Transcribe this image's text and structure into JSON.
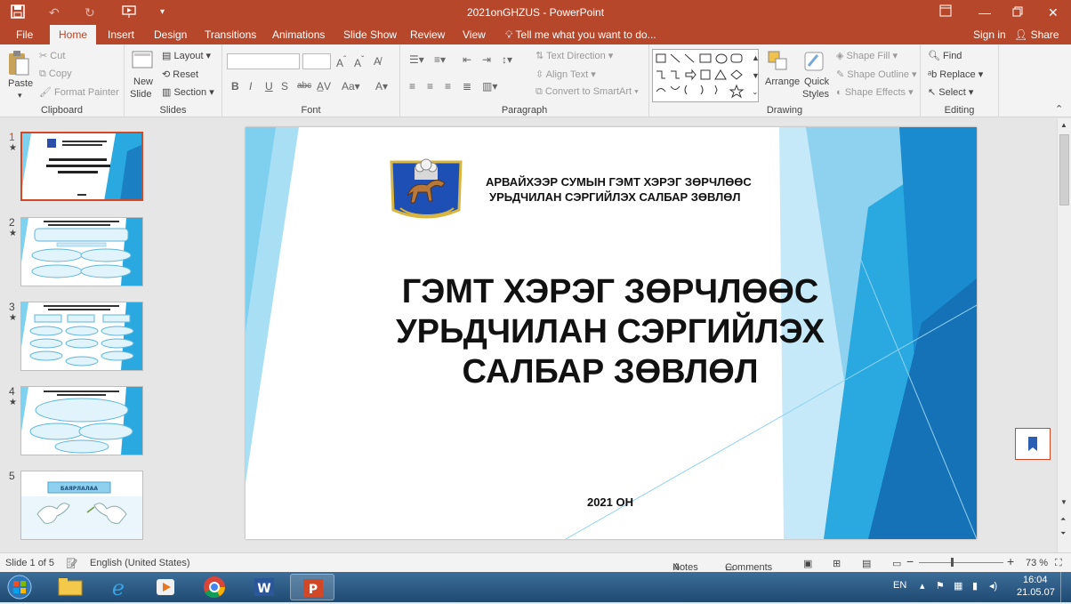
{
  "window": {
    "title": "2021onGHZUS - PowerPoint"
  },
  "tabs": [
    "File",
    "Home",
    "Insert",
    "Design",
    "Transitions",
    "Animations",
    "Slide Show",
    "Review",
    "View"
  ],
  "tellme": "Tell me what you want to do...",
  "account": {
    "signin": "Sign in",
    "share": "Share"
  },
  "clipboard": {
    "paste": "Paste",
    "cut": "Cut",
    "copy": "Copy",
    "format_painter": "Format Painter",
    "label": "Clipboard"
  },
  "slides_group": {
    "new_slide_1": "New",
    "new_slide_2": "Slide",
    "layout": "Layout",
    "reset": "Reset",
    "section": "Section",
    "label": "Slides"
  },
  "font_group": {
    "label": "Font"
  },
  "paragraph_group": {
    "text_direction": "Text Direction",
    "align_text": "Align Text",
    "convert_smartart": "Convert to SmartArt",
    "label": "Paragraph"
  },
  "drawing_group": {
    "arrange": "Arrange",
    "quick_styles_1": "Quick",
    "quick_styles_2": "Styles",
    "shape_fill": "Shape Fill",
    "shape_outline": "Shape Outline",
    "shape_effects": "Shape Effects",
    "label": "Drawing"
  },
  "editing_group": {
    "find": "Find",
    "replace": "Replace",
    "select": "Select",
    "label": "Editing"
  },
  "thumbnails": [
    {
      "num": "1",
      "star": "★"
    },
    {
      "num": "2",
      "star": "★"
    },
    {
      "num": "3",
      "star": "★"
    },
    {
      "num": "4",
      "star": "★"
    },
    {
      "num": "5",
      "star": ""
    }
  ],
  "thumb5_banner": "БАЯРЛАЛАА",
  "slide": {
    "header_line1": "АРВАЙХЭЭР СУМЫН ГЭМТ ХЭРЭГ ЗӨРЧЛӨӨС",
    "header_line2": "УРЬДЧИЛАН СЭРГИЙЛЭХ САЛБАР ЗӨВЛӨЛ",
    "title_line1": "ГЭМТ ХЭРЭГ ЗӨРЧЛӨӨС",
    "title_line2": "УРЬДЧИЛАН СЭРГИЙЛЭХ",
    "title_line3": "САЛБАР ЗӨВЛӨЛ",
    "year": "2021 ОН"
  },
  "statusbar": {
    "slide_info": "Slide 1 of 5",
    "language": "English (United States)",
    "notes": "Notes",
    "comments": "Comments",
    "zoom": "73 %"
  },
  "tray": {
    "lang": "EN",
    "time": "16:04",
    "date": "21.05.07"
  },
  "colors": {
    "accent": "#b7472a",
    "slide_blue": "#29a9e0"
  }
}
